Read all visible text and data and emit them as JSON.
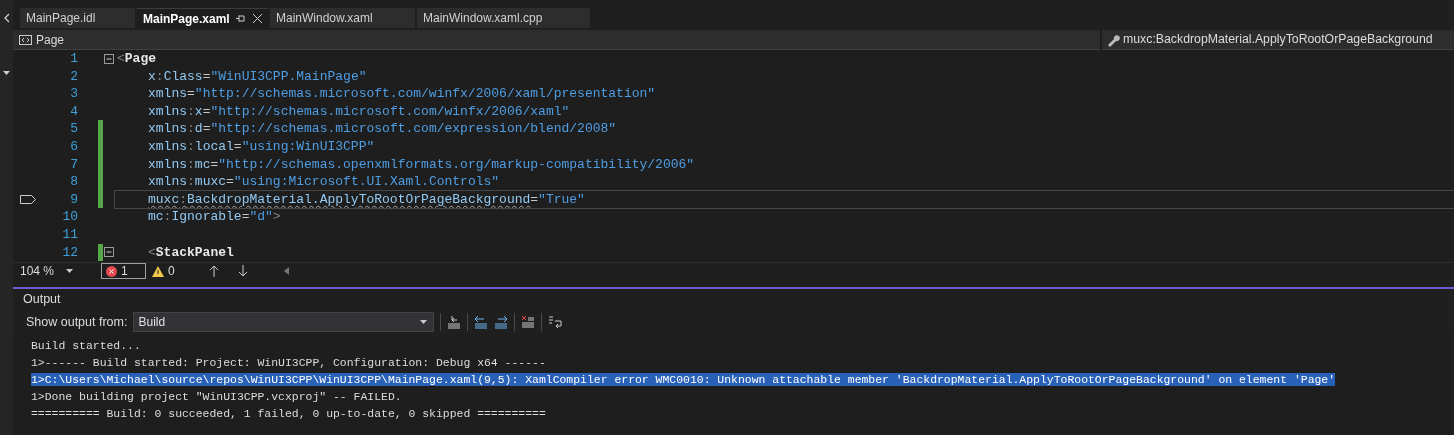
{
  "tabs": [
    {
      "label": "MainPage.idl",
      "selected": false
    },
    {
      "label": "MainPage.xaml",
      "selected": true
    },
    {
      "label": "MainWindow.xaml",
      "selected": false
    },
    {
      "label": "MainWindow.xaml.cpp",
      "selected": false
    }
  ],
  "navigation": {
    "type": "Page",
    "member": "muxc:BackdropMaterial.ApplyToRootOrPageBackground"
  },
  "editor": {
    "lines": [
      {
        "number": "1",
        "changed": false,
        "current": false,
        "expanded": true,
        "tokens": [
          {
            "text": "<",
            "kind": "punct",
            "error": false
          },
          {
            "text": "Page",
            "kind": "element",
            "error": false
          }
        ],
        "children": [
          {
            "number": "2",
            "changed": false,
            "current": false,
            "tokens": [
              {
                "text": "x",
                "kind": "attr",
                "error": false
              },
              {
                "text": ":",
                "kind": "punct",
                "error": false
              },
              {
                "text": "Class",
                "kind": "attr",
                "error": false
              },
              {
                "text": "=",
                "kind": "punct",
                "error": false
              },
              {
                "text": "\"WinUI3CPP.MainPage\"",
                "kind": "value",
                "error": false
              }
            ]
          },
          {
            "number": "3",
            "changed": false,
            "current": false,
            "tokens": [
              {
                "text": "xmlns",
                "kind": "attr",
                "error": false
              },
              {
                "text": "=",
                "kind": "punct",
                "error": false
              },
              {
                "text": "\"http://schemas.microsoft.com/winfx/2006/xaml/presentation\"",
                "kind": "value",
                "error": false
              }
            ]
          },
          {
            "number": "4",
            "changed": false,
            "current": false,
            "tokens": [
              {
                "text": "xmlns",
                "kind": "attr",
                "error": false
              },
              {
                "text": ":",
                "kind": "punct",
                "error": false
              },
              {
                "text": "x",
                "kind": "attr",
                "error": false
              },
              {
                "text": "=",
                "kind": "punct",
                "error": false
              },
              {
                "text": "\"http://schemas.microsoft.com/winfx/2006/xaml\"",
                "kind": "value",
                "error": false
              }
            ]
          },
          {
            "number": "5",
            "changed": true,
            "current": false,
            "tokens": [
              {
                "text": "xmlns",
                "kind": "attr",
                "error": false
              },
              {
                "text": ":",
                "kind": "punct",
                "error": false
              },
              {
                "text": "d",
                "kind": "attr",
                "error": false
              },
              {
                "text": "=",
                "kind": "punct",
                "error": false
              },
              {
                "text": "\"http://schemas.microsoft.com/expression/blend/2008\"",
                "kind": "value",
                "error": false
              }
            ]
          },
          {
            "number": "6",
            "changed": true,
            "current": false,
            "tokens": [
              {
                "text": "xmlns",
                "kind": "attr",
                "error": false
              },
              {
                "text": ":",
                "kind": "punct",
                "error": false
              },
              {
                "text": "local",
                "kind": "attr",
                "error": false
              },
              {
                "text": "=",
                "kind": "punct",
                "error": false
              },
              {
                "text": "\"using:WinUI3CPP\"",
                "kind": "value",
                "error": false
              }
            ]
          },
          {
            "number": "7",
            "changed": true,
            "current": false,
            "tokens": [
              {
                "text": "xmlns",
                "kind": "attr",
                "error": false
              },
              {
                "text": ":",
                "kind": "punct",
                "error": false
              },
              {
                "text": "mc",
                "kind": "attr",
                "error": false
              },
              {
                "text": "=",
                "kind": "punct",
                "error": false
              },
              {
                "text": "\"http://schemas.openxmlformats.org/markup-compatibility/2006\"",
                "kind": "value",
                "error": false
              }
            ]
          },
          {
            "number": "8",
            "changed": true,
            "current": false,
            "tokens": [
              {
                "text": "xmlns",
                "kind": "attr",
                "error": false
              },
              {
                "text": ":",
                "kind": "punct",
                "error": false
              },
              {
                "text": "muxc",
                "kind": "attr",
                "error": false
              },
              {
                "text": "=",
                "kind": "punct",
                "error": false
              },
              {
                "text": "\"using:Microsoft.UI.Xaml.Controls\"",
                "kind": "value",
                "error": false
              }
            ]
          },
          {
            "number": "9",
            "changed": true,
            "current": true,
            "tokens": [
              {
                "text": "muxc",
                "kind": "attr",
                "error": true
              },
              {
                "text": ":",
                "kind": "punct",
                "error": true
              },
              {
                "text": "BackdropMaterial.ApplyToRootOrPageBackground",
                "kind": "attr",
                "error": true
              },
              {
                "text": "=",
                "kind": "punct",
                "error": false
              },
              {
                "text": "\"True\"",
                "kind": "value",
                "error": false
              }
            ]
          },
          {
            "number": "10",
            "changed": false,
            "current": false,
            "tokens": [
              {
                "text": "mc",
                "kind": "attr",
                "error": false
              },
              {
                "text": ":",
                "kind": "punct",
                "error": false
              },
              {
                "text": "Ignorable",
                "kind": "attr",
                "error": false
              },
              {
                "text": "=",
                "kind": "punct",
                "error": false
              },
              {
                "text": "\"d\"",
                "kind": "value",
                "error": false
              },
              {
                "text": ">",
                "kind": "punct",
                "error": false
              }
            ]
          },
          {
            "number": "11",
            "changed": false,
            "current": false
          },
          {
            "number": "12",
            "changed": true,
            "current": false,
            "expanded": true,
            "tokens": [
              {
                "text": "<",
                "kind": "punct",
                "error": false
              },
              {
                "text": "StackPanel",
                "kind": "element",
                "error": false
              }
            ]
          }
        ]
      }
    ],
    "zoom": "104 %",
    "errors": "1",
    "warnings": "0"
  },
  "output": {
    "title": "Output",
    "source_label": "Show output from:",
    "source": "Build",
    "lines": [
      {
        "text": "Build started...",
        "selected": false
      },
      {
        "text": "1>------ Build started: Project: WinUI3CPP, Configuration: Debug x64 ------",
        "selected": false
      },
      {
        "text": "1>C:\\Users\\Michael\\source\\repos\\WinUI3CPP\\WinUI3CPP\\MainPage.xaml(9,5): XamlCompiler error WMC0010: Unknown attachable member 'BackdropMaterial.ApplyToRootOrPageBackground' on element 'Page'",
        "selected": true
      },
      {
        "text": "1>Done building project \"WinUI3CPP.vcxproj\" -- FAILED.",
        "selected": false
      },
      {
        "text": "========== Build: 0 succeeded, 1 failed, 0 up-to-date, 0 skipped ==========",
        "selected": false
      }
    ]
  }
}
